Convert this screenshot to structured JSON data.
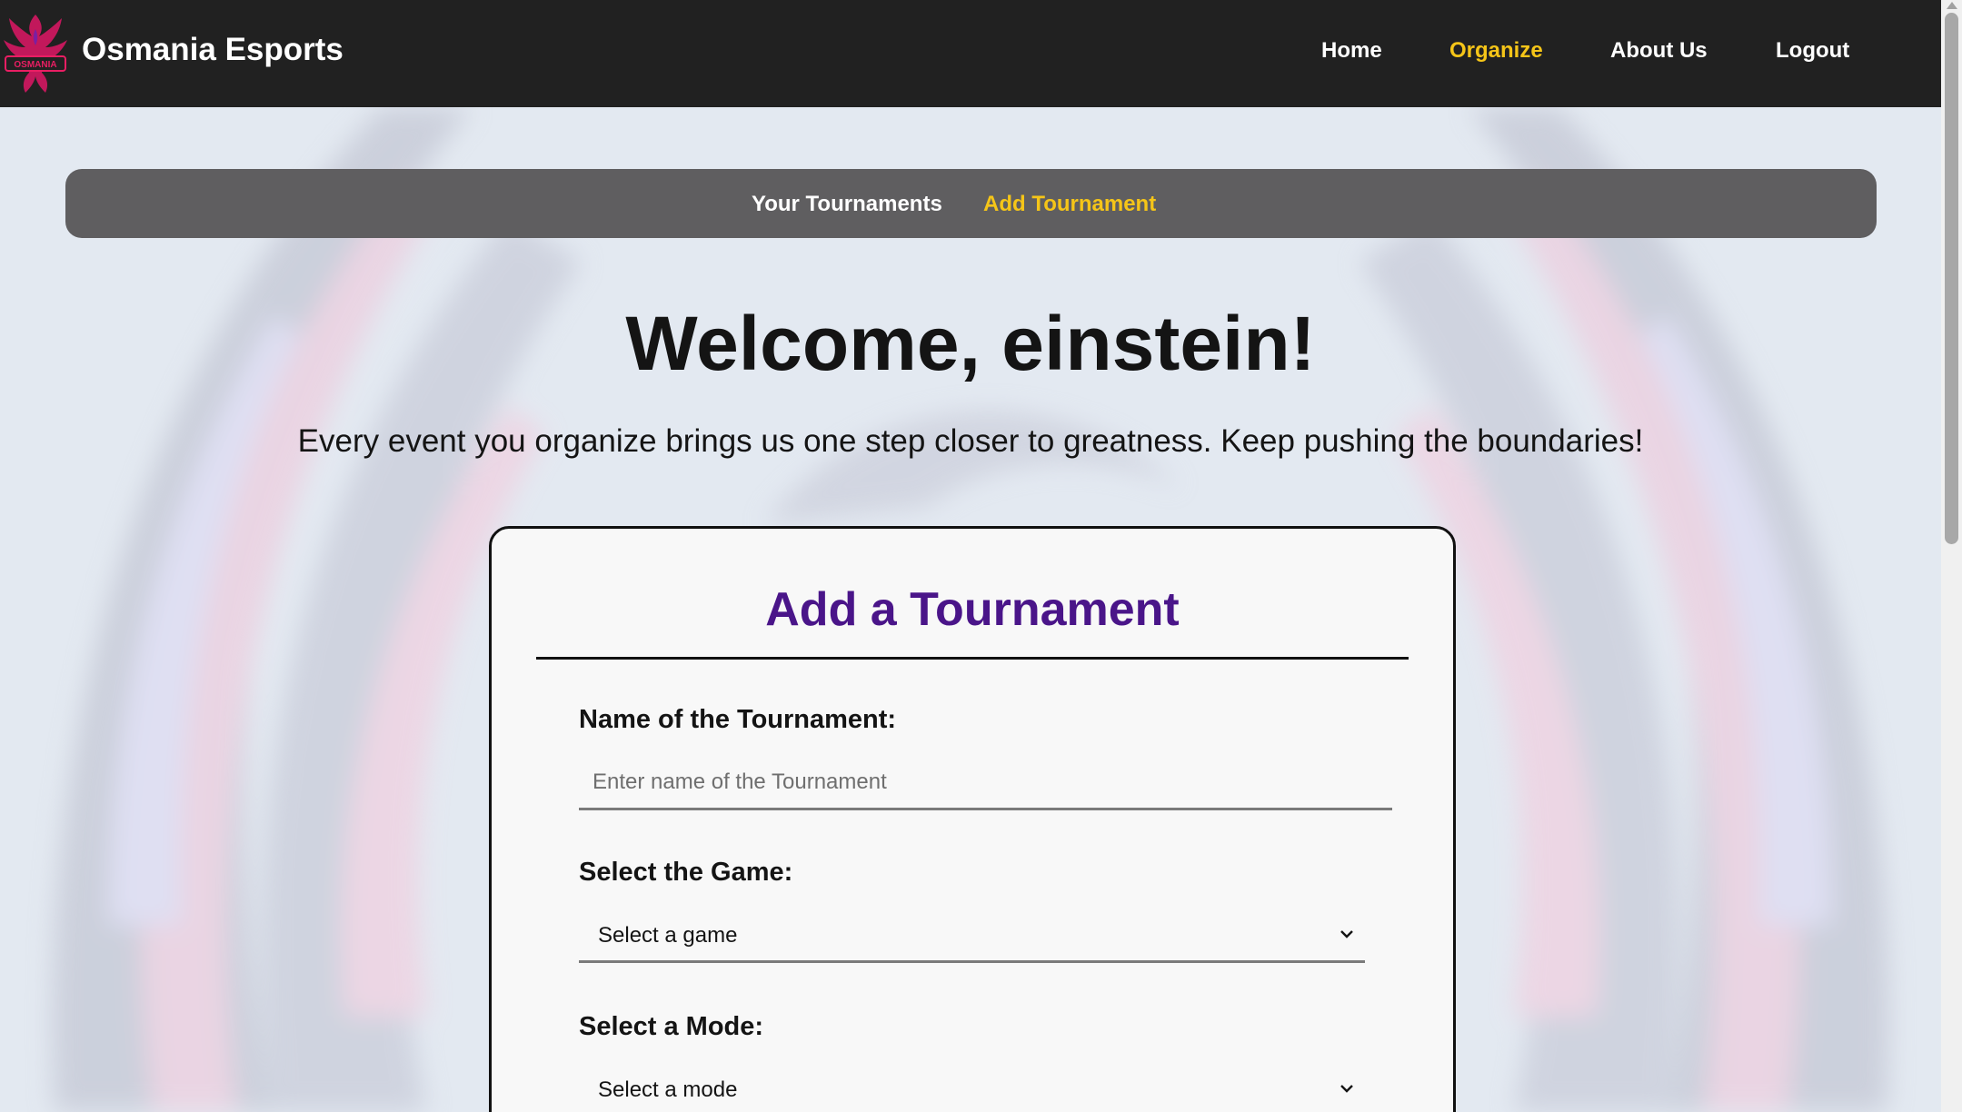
{
  "brand": {
    "name": "Osmania Esports",
    "logo_icon": "phoenix-logo-icon",
    "logo_text": "OSMANIA"
  },
  "nav": {
    "items": [
      {
        "label": "Home",
        "active": false
      },
      {
        "label": "Organize",
        "active": true
      },
      {
        "label": "About Us",
        "active": false
      },
      {
        "label": "Logout",
        "active": false
      }
    ]
  },
  "subnav": {
    "items": [
      {
        "label": "Your Tournaments",
        "active": false
      },
      {
        "label": "Add Tournament",
        "active": true
      }
    ]
  },
  "welcome": {
    "heading": "Welcome, einstein!",
    "tagline": "Every event you organize brings us one step closer to greatness. Keep pushing the boundaries!"
  },
  "form": {
    "title": "Add a Tournament",
    "name_label": "Name of the Tournament:",
    "name_placeholder": "Enter name of the Tournament",
    "name_value": "",
    "game_label": "Select the Game:",
    "game_selected": "Select a game",
    "mode_label": "Select a Mode:",
    "mode_selected": "Select a mode"
  },
  "colors": {
    "navbar_bg": "#212121",
    "active_link": "#f5c518",
    "subnav_bg": "#5f5e60",
    "form_title": "#4a1589",
    "page_bg": "#e3e9f1"
  }
}
